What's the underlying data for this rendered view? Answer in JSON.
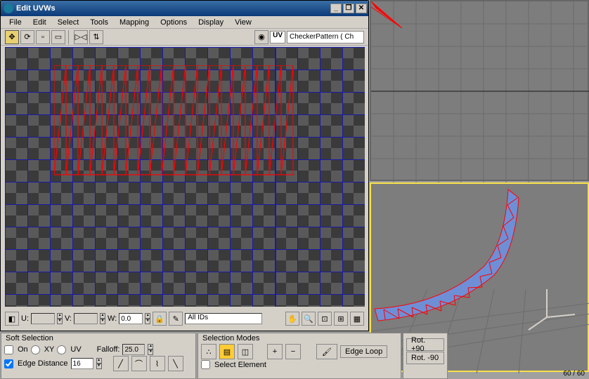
{
  "window": {
    "title": "Edit UVWs",
    "minimize_tooltip": "Minimize",
    "restore_tooltip": "Restore",
    "close_tooltip": "Close"
  },
  "menu": {
    "file": "File",
    "edit": "Edit",
    "select": "Select",
    "tools": "Tools",
    "mapping": "Mapping",
    "options": "Options",
    "display": "Display",
    "view": "View"
  },
  "toolbar": {
    "uv_label": "UV",
    "texture_field": "CheckerPattern  ( Ch"
  },
  "status": {
    "u_label": "U:",
    "u_value": "",
    "v_label": "V:",
    "v_value": "",
    "w_label": "W:",
    "w_value": "0.0",
    "ids_label": "All IDs"
  },
  "soft_selection": {
    "legend": "Soft Selection",
    "on_label": "On",
    "xy_label": "XY",
    "uv_label": "UV",
    "falloff_label": "Falloff:",
    "falloff_value": "25.0",
    "edge_distance_label": "Edge Distance",
    "edge_distance_value": "16"
  },
  "selection_modes": {
    "legend": "Selection Modes",
    "edge_loop_label": "Edge Loop",
    "select_element_label": "Select Element"
  },
  "rotation": {
    "plus_label": "Rot. +90",
    "minus_label": "Rot. -90"
  },
  "viewport": {
    "fov_display": "60 / 60"
  }
}
